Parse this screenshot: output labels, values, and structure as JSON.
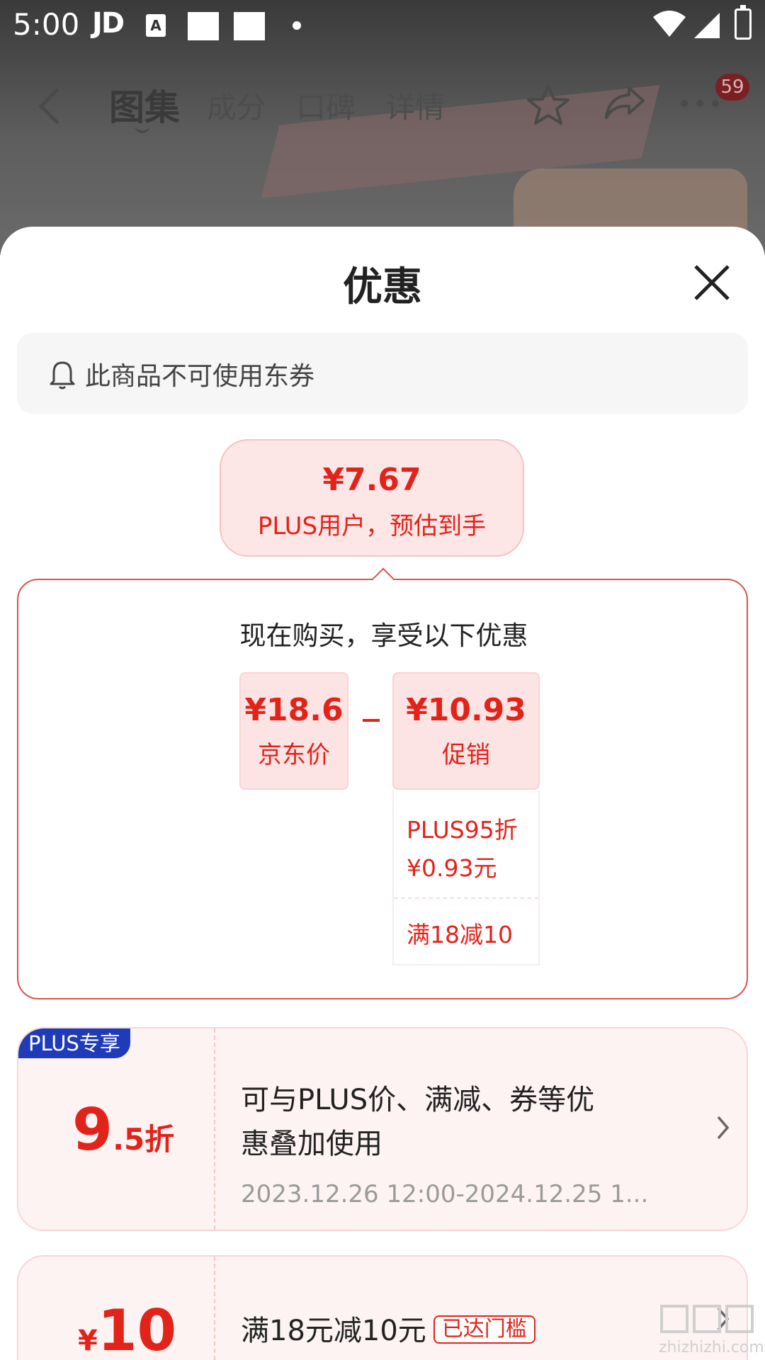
{
  "status_bar": {
    "time": "5:00",
    "carrier": "JD",
    "notif_a": "A"
  },
  "nav": {
    "tabs": [
      {
        "label": "图集",
        "active": true
      },
      {
        "label": "成分",
        "active": false
      },
      {
        "label": "口碑",
        "active": false
      },
      {
        "label": "详情",
        "active": false
      }
    ],
    "badge": "59"
  },
  "sheet": {
    "title": "优惠",
    "notice": "此商品不可使用东券",
    "estimate": {
      "price": "¥7.67",
      "label": "PLUS用户，预估到手"
    },
    "detail": {
      "heading": "现在购买，享受以下优惠",
      "base_price": {
        "value": "¥18.6",
        "label": "京东价"
      },
      "promo_price": {
        "value": "¥10.93",
        "label": "促销"
      },
      "promo_items": [
        "PLUS95折",
        "¥0.93元",
        "满18减10"
      ]
    },
    "coupons": [
      {
        "tag": "PLUS专享",
        "amount_big": "9",
        "amount_small": ".5折",
        "line1": "可与PLUS价、满减、券等优",
        "line2": "惠叠加使用",
        "date": "2023.12.26 12:00-2024.12.25 1..."
      },
      {
        "currency": "¥",
        "amount": "10",
        "desc": "满18元减10元",
        "badge": "已达门槛"
      }
    ]
  },
  "watermark": "zhizhizhi.com",
  "colors": {
    "accent": "#e2231a",
    "plus_tag": "#1f3bb8",
    "pink_bg": "#fde6e6"
  }
}
